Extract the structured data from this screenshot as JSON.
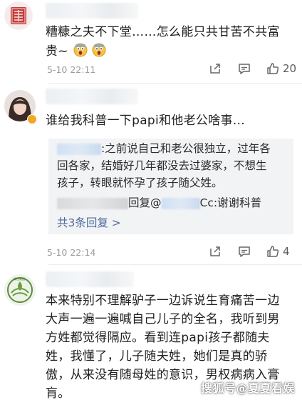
{
  "comments": [
    {
      "text_lines": [
        "糟糠之夫不下堂……怎么能只共甘苦不共富",
        "贵~"
      ],
      "time": "5-10 22:11",
      "likes": "20"
    },
    {
      "text": "谁给我科普一下papi和他老公啥事...",
      "reply": {
        "line1_suffix": ":之前说自己和老公很独立，过年各",
        "line2": "回各家，结婚好几年都没去过婆家，不想生",
        "line3": "孩子，转眼就怀孕了孩子随父姓。",
        "line4_mid": "回复@",
        "line4_suffix": "Cc:谢谢科普",
        "more": "共3条回复 >"
      },
      "time": "5-10 22:14",
      "likes": "4"
    },
    {
      "avatar_badge": "绿色家园",
      "text_lines": [
        "本来特别不理解驴子一边诉说生育痛苦一边",
        "大声一遍一遍喊自己儿子的全名，我听到男",
        "方姓都觉得隔应。看到连papi孩子都随夫",
        "姓，我懂了，儿子随夫姓，她们是真的骄",
        "傲，从来没有随母姓的意识，男权病病入膏",
        "肓。"
      ]
    }
  ],
  "watermark": "搜狐号@夏夏看娱",
  "colors": {
    "link": "#4e6a9b",
    "meta": "#9b9b9b",
    "reply_bg": "#f2f3f5"
  }
}
